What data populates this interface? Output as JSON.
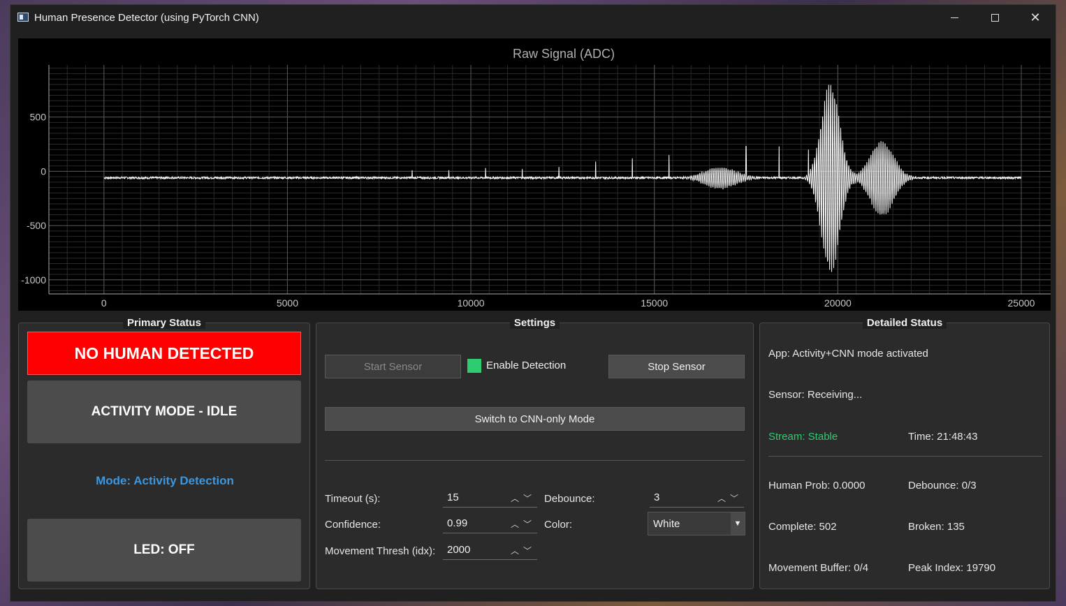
{
  "window": {
    "title": "Human Presence Detector (using PyTorch CNN)",
    "icon": "app-window-icon"
  },
  "chart_data": {
    "type": "line",
    "title": "Raw Signal (ADC)",
    "xlabel": "",
    "ylabel": "",
    "xlim": [
      -1500,
      25800
    ],
    "ylim": [
      -1130,
      980
    ],
    "xticks": [
      "0",
      "5000",
      "10000",
      "15000",
      "20000",
      "25000"
    ],
    "yticks": [
      "500",
      "0",
      "-500",
      "-1000"
    ],
    "grid": true,
    "series": [
      {
        "name": "",
        "color": "#ffffff",
        "description_points": {
          "baseline": -60,
          "x_start": 0,
          "x_end": 25000,
          "bursts": [
            {
              "center": 19800,
              "amp_hi": 820,
              "amp_lo": -950,
              "width": 700
            },
            {
              "center": 21200,
              "amp_hi": 280,
              "amp_lo": -420,
              "width": 900
            },
            {
              "center": 16800,
              "amp_hi": 40,
              "amp_lo": -160,
              "width": 1200
            }
          ],
          "spikes": [
            [
              8400,
              10
            ],
            [
              9400,
              10
            ],
            [
              10400,
              30
            ],
            [
              11400,
              20
            ],
            [
              12400,
              40
            ],
            [
              13400,
              90
            ],
            [
              14400,
              120
            ],
            [
              15400,
              150
            ],
            [
              17500,
              230
            ],
            [
              18400,
              230
            ],
            [
              19200,
              200
            ]
          ]
        }
      }
    ]
  },
  "primary": {
    "title": "Primary Status",
    "detection": "NO HUMAN DETECTED",
    "activity": "ACTIVITY MODE - IDLE",
    "mode": "Mode: Activity Detection",
    "led": "LED: OFF"
  },
  "settings": {
    "title": "Settings",
    "start_sensor": "Start Sensor",
    "enable_detection": "Enable Detection",
    "stop_sensor": "Stop Sensor",
    "switch_mode": "Switch to CNN-only Mode",
    "timeout_label": "Timeout (s):",
    "timeout_value": "15",
    "debounce_label": "Debounce:",
    "debounce_value": "3",
    "confidence_label": "Confidence:",
    "confidence_value": "0.99",
    "color_label": "Color:",
    "color_value": "White",
    "movement_label": "Movement Thresh (idx):",
    "movement_value": "2000"
  },
  "detailed": {
    "title": "Detailed Status",
    "app": "App: Activity+CNN mode activated",
    "sensor": "Sensor: Receiving...",
    "stream": "Stream: Stable",
    "time": "Time: 21:48:43",
    "human_prob": "Human Prob: 0.0000",
    "debounce": "Debounce: 0/3",
    "complete": "Complete: 502",
    "broken": "Broken: 135",
    "movement_buffer": "Movement Buffer: 0/4",
    "peak_index": "Peak Index: 19790"
  }
}
